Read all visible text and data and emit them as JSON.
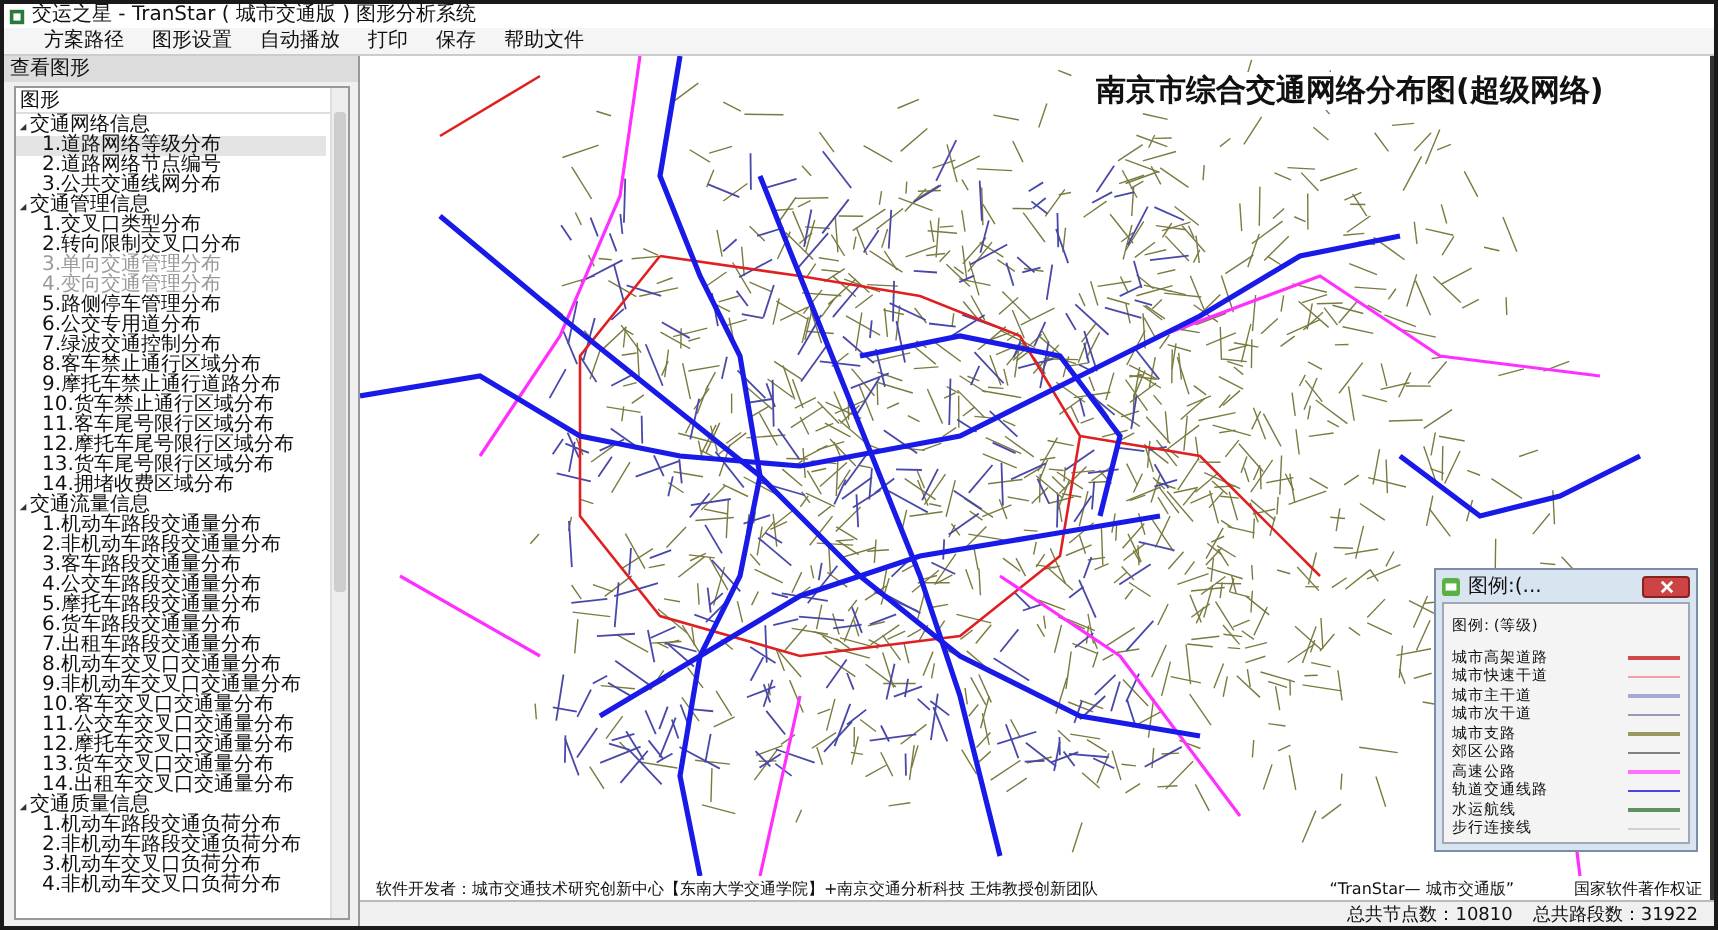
{
  "window": {
    "title": "交运之星 - TranStar ( 城市交通版 ) 图形分析系统"
  },
  "menu": [
    "方案路径",
    "图形设置",
    "自动播放",
    "打印",
    "保存",
    "帮助文件"
  ],
  "sidebar": {
    "title": "查看图形",
    "tree_header": "图形",
    "groups": [
      {
        "label": "交通网络信息",
        "expanded": true,
        "children": [
          {
            "label": "1.道路网络等级分布",
            "selected": true,
            "disabled": false
          },
          {
            "label": "2.道路网络节点编号",
            "selected": false,
            "disabled": false
          },
          {
            "label": "3.公共交通线网分布",
            "selected": false,
            "disabled": false
          }
        ]
      },
      {
        "label": "交通管理信息",
        "expanded": true,
        "children": [
          {
            "label": "1.交叉口类型分布",
            "selected": false,
            "disabled": false
          },
          {
            "label": "2.转向限制交叉口分布",
            "selected": false,
            "disabled": false
          },
          {
            "label": "3.单向交通管理分布",
            "selected": false,
            "disabled": true
          },
          {
            "label": "4.变向交通管理分布",
            "selected": false,
            "disabled": true
          },
          {
            "label": "5.路侧停车管理分布",
            "selected": false,
            "disabled": false
          },
          {
            "label": "6.公交专用道分布",
            "selected": false,
            "disabled": false
          },
          {
            "label": "7.绿波交通控制分布",
            "selected": false,
            "disabled": false
          },
          {
            "label": "8.客车禁止通行区域分布",
            "selected": false,
            "disabled": false
          },
          {
            "label": "9.摩托车禁止通行道路分布",
            "selected": false,
            "disabled": false
          },
          {
            "label": "10.货车禁止通行区域分布",
            "selected": false,
            "disabled": false
          },
          {
            "label": "11.客车尾号限行区域分布",
            "selected": false,
            "disabled": false
          },
          {
            "label": "12.摩托车尾号限行区域分布",
            "selected": false,
            "disabled": false
          },
          {
            "label": "13.货车尾号限行区域分布",
            "selected": false,
            "disabled": false
          },
          {
            "label": "14.拥堵收费区域分布",
            "selected": false,
            "disabled": false
          }
        ]
      },
      {
        "label": "交通流量信息",
        "expanded": true,
        "children": [
          {
            "label": "1.机动车路段交通量分布",
            "selected": false,
            "disabled": false
          },
          {
            "label": "2.非机动车路段交通量分布",
            "selected": false,
            "disabled": false
          },
          {
            "label": "3.客车路段交通量分布",
            "selected": false,
            "disabled": false
          },
          {
            "label": "4.公交车路段交通量分布",
            "selected": false,
            "disabled": false
          },
          {
            "label": "5.摩托车路段交通量分布",
            "selected": false,
            "disabled": false
          },
          {
            "label": "6.货车路段交通量分布",
            "selected": false,
            "disabled": false
          },
          {
            "label": "7.出租车路段交通量分布",
            "selected": false,
            "disabled": false
          },
          {
            "label": "8.机动车交叉口交通量分布",
            "selected": false,
            "disabled": false
          },
          {
            "label": "9.非机动车交叉口交通量分布",
            "selected": false,
            "disabled": false
          },
          {
            "label": "10.客车交叉口交通量分布",
            "selected": false,
            "disabled": false
          },
          {
            "label": "11.公交车交叉口交通量分布",
            "selected": false,
            "disabled": false
          },
          {
            "label": "12.摩托车交叉口交通量分布",
            "selected": false,
            "disabled": false
          },
          {
            "label": "13.货车交叉口交通量分布",
            "selected": false,
            "disabled": false
          },
          {
            "label": "14.出租车交叉口交通量分布",
            "selected": false,
            "disabled": false
          }
        ]
      },
      {
        "label": "交通质量信息",
        "expanded": true,
        "children": [
          {
            "label": "1.机动车路段交通负荷分布",
            "selected": false,
            "disabled": false
          },
          {
            "label": "2.非机动车路段交通负荷分布",
            "selected": false,
            "disabled": false
          },
          {
            "label": "3.机动车交叉口负荷分布",
            "selected": false,
            "disabled": false
          },
          {
            "label": "4.非机动车交叉口负荷分布",
            "selected": false,
            "disabled": false
          }
        ]
      }
    ]
  },
  "map": {
    "title": "南京市综合交通网络分布图(超级网络)"
  },
  "legend": {
    "title": "图例:(...",
    "subtitle": "图例: (等级)",
    "items": [
      {
        "label": "城市高架道路",
        "color": "#d04848"
      },
      {
        "label": "城市快速干道",
        "color": "#f0a0a8"
      },
      {
        "label": "城市主干道",
        "color": "#a8a8d8"
      },
      {
        "label": "城市次干道",
        "color": "#9898b8"
      },
      {
        "label": "城市支路",
        "color": "#989860"
      },
      {
        "label": "郊区公路",
        "color": "#808080"
      },
      {
        "label": "高速公路",
        "color": "#ff70ff"
      },
      {
        "label": "轨道交通线路",
        "color": "#4848e0"
      },
      {
        "label": "水运航线",
        "color": "#609060"
      },
      {
        "label": "步行连接线",
        "color": "#d0d0d0"
      }
    ]
  },
  "credits": {
    "developer": "软件开发者：城市交通技术研究创新中心【东南大学交通学院】+南京交通分析科技 王炜教授创新团队",
    "product": "“TranStar— 城市交通版”",
    "copyright": "国家软件著作权证"
  },
  "status_bar": [
    "总共节点数：10810",
    "总共路段数：31922"
  ]
}
